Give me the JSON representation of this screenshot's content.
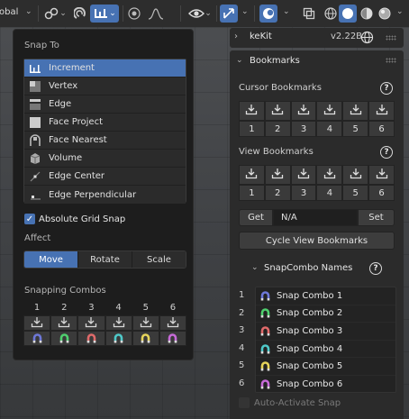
{
  "toolbar": {
    "orientation_label": "obal",
    "items": [
      "transform-pivot-icon",
      "proportional-icon",
      "snap-toggle-icon",
      "snap-target-icon",
      "proportional-edit-icon",
      "falloff-curve-icon",
      "visibility-icon",
      "gizmo-icon",
      "overlay-icon",
      "xray-icon",
      "wireframe-shading-icon",
      "solid-shading-icon",
      "material-shading-icon",
      "rendered-shading-icon"
    ]
  },
  "snap_popup": {
    "snap_to_header": "Snap To",
    "options": [
      {
        "label": "Increment",
        "icon": "increment-icon",
        "selected": true
      },
      {
        "label": "Vertex",
        "icon": "vertex-icon",
        "selected": false
      },
      {
        "label": "Edge",
        "icon": "edge-icon",
        "selected": false
      },
      {
        "label": "Face Project",
        "icon": "face-project-icon",
        "selected": false
      },
      {
        "label": "Face Nearest",
        "icon": "face-nearest-icon",
        "selected": false
      },
      {
        "label": "Volume",
        "icon": "volume-icon",
        "selected": false
      },
      {
        "label": "Edge Center",
        "icon": "edge-center-icon",
        "selected": false
      },
      {
        "label": "Edge Perpendicular",
        "icon": "edge-perpendicular-icon",
        "selected": false
      }
    ],
    "absolute_grid_snap": "Absolute Grid Snap",
    "affect_header": "Affect",
    "affect": [
      "Move",
      "Rotate",
      "Scale"
    ],
    "combos_header": "Snapping Combos",
    "combo_numbers": [
      "1",
      "2",
      "3",
      "4",
      "5",
      "6"
    ],
    "combo_colors": [
      "#6e78d8",
      "#4fcf6e",
      "#e06a6a",
      "#4fc9c9",
      "#e6d45a",
      "#c76ad8"
    ]
  },
  "kekit": {
    "title": "keKit",
    "version": "v2.22B"
  },
  "bookmarks": {
    "header": "Bookmarks",
    "cursor_header": "Cursor Bookmarks",
    "view_header": "View Bookmarks",
    "numbers": [
      "1",
      "2",
      "3",
      "4",
      "5",
      "6"
    ],
    "get_label": "Get",
    "value": "N/A",
    "set_label": "Set",
    "cycle_label": "Cycle View Bookmarks",
    "snapcombo_header": "SnapCombo Names",
    "combos": [
      {
        "num": "1",
        "name": "Snap Combo 1",
        "color": "#6e78d8"
      },
      {
        "num": "2",
        "name": "Snap Combo 2",
        "color": "#4fcf6e"
      },
      {
        "num": "3",
        "name": "Snap Combo 3",
        "color": "#e06a6a"
      },
      {
        "num": "4",
        "name": "Snap Combo 4",
        "color": "#4fc9c9"
      },
      {
        "num": "5",
        "name": "Snap Combo 5",
        "color": "#e6d45a"
      },
      {
        "num": "6",
        "name": "Snap Combo 6",
        "color": "#c76ad8"
      }
    ],
    "auto_activate": "Auto-Activate Snap"
  }
}
